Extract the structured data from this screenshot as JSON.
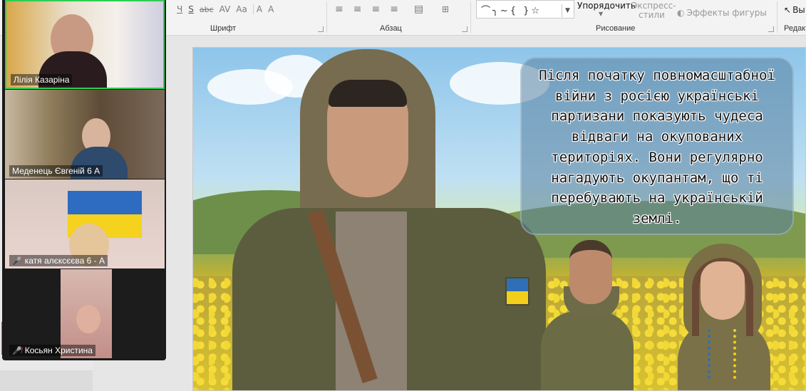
{
  "ribbon": {
    "font_row": [
      "Ч",
      "S",
      "abc",
      "AV",
      "Aa",
      "A",
      "A"
    ],
    "group_font": "Шрифт",
    "group_paragraph": "Абзац",
    "group_drawing": "Рисование",
    "group_edit": "Редакт",
    "arrange": "Упорядочить",
    "quick_styles_line1": "Экспресс-",
    "quick_styles_line2": "стили",
    "shape_effects": "Эффекты фигуры",
    "select": "Вы",
    "shapes_preview": "⌒╮~{ }☆"
  },
  "slide": {
    "text": "Після початку повномасштабної війни з росією українські партизани показують чудеса відваги на окупованих територіях. Вони регулярно нагадують окупантам, що ті перебувають на українській землі."
  },
  "participants": [
    {
      "name": "Лілія Казаріна",
      "muted": false,
      "active": true
    },
    {
      "name": "Меденець Євгеній 6 А",
      "muted": false,
      "active": false
    },
    {
      "name": "катя алєксєєва 6 - А",
      "muted": true,
      "active": false
    },
    {
      "name": "Косьян Христина",
      "muted": true,
      "active": false
    }
  ],
  "colors": {
    "active_speaker": "#2fce54",
    "mute_icon": "#e23b3b",
    "thumb_selected": "#c0504d"
  }
}
